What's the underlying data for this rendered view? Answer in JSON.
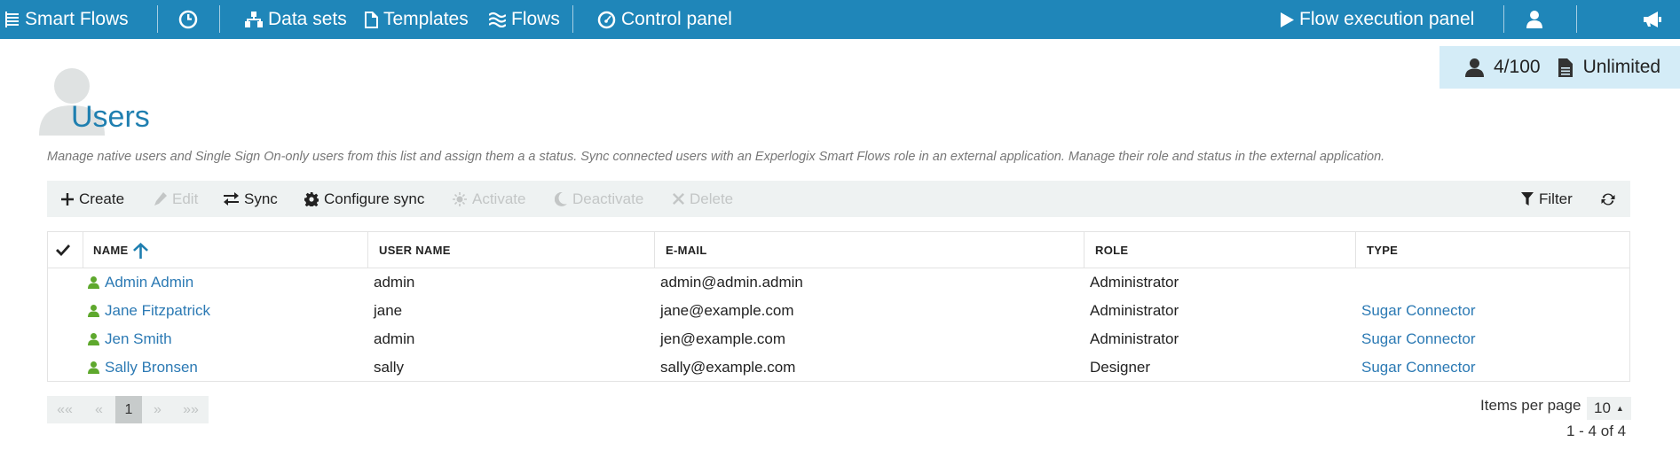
{
  "nav": {
    "brand": "Smart Flows",
    "datasets": "Data sets",
    "templates": "Templates",
    "flows": "Flows",
    "control_panel": "Control panel",
    "execution_panel": "Flow execution panel",
    "icons": [
      "layers-icon",
      "history-icon",
      "sitemap-icon",
      "file-icon",
      "waves-icon",
      "dashboard-icon",
      "play-icon",
      "user-icon",
      "megaphone-icon"
    ]
  },
  "quota": {
    "users": "4/100",
    "documents": "Unlimited"
  },
  "header": {
    "title": "Users",
    "description": "Manage native users and Single Sign On-only users from this list and assign them a a status. Sync connected users with an Experlogix Smart Flows role in an external application. Manage their role and status in the external application."
  },
  "toolbar": {
    "create": "Create",
    "edit": "Edit",
    "sync": "Sync",
    "configure_sync": "Configure sync",
    "activate": "Activate",
    "deactivate": "Deactivate",
    "delete": "Delete",
    "filter": "Filter"
  },
  "grid": {
    "columns": {
      "name": "NAME",
      "username": "USER NAME",
      "email": "E-MAIL",
      "role": "ROLE",
      "type": "TYPE"
    },
    "sort": {
      "column": "name",
      "direction": "ascending"
    },
    "rows": [
      {
        "name": "Admin Admin",
        "username": "admin",
        "email": "admin@admin.admin",
        "role": "Administrator",
        "type": ""
      },
      {
        "name": "Jane Fitzpatrick",
        "username": "jane",
        "email": "jane@example.com",
        "role": "Administrator",
        "type": "Sugar Connector"
      },
      {
        "name": "Jen Smith",
        "username": "admin",
        "email": "jen@example.com",
        "role": "Administrator",
        "type": "Sugar Connector"
      },
      {
        "name": "Sally Bronsen",
        "username": "sally",
        "email": "sally@example.com",
        "role": "Designer",
        "type": "Sugar Connector"
      }
    ]
  },
  "pager": {
    "first": "««",
    "prev": "«",
    "current": "1",
    "next": "»",
    "last": "»»",
    "items_per_page_label": "Items per page",
    "items_per_page": "10",
    "range": "1 - 4 of 4"
  },
  "colors": {
    "nav_bg": "#1f86b9",
    "title": "#1f7fb0",
    "link": "#2c7ab4",
    "user_icon": "#5ea82d",
    "quota_bg": "#d4ecf7"
  }
}
